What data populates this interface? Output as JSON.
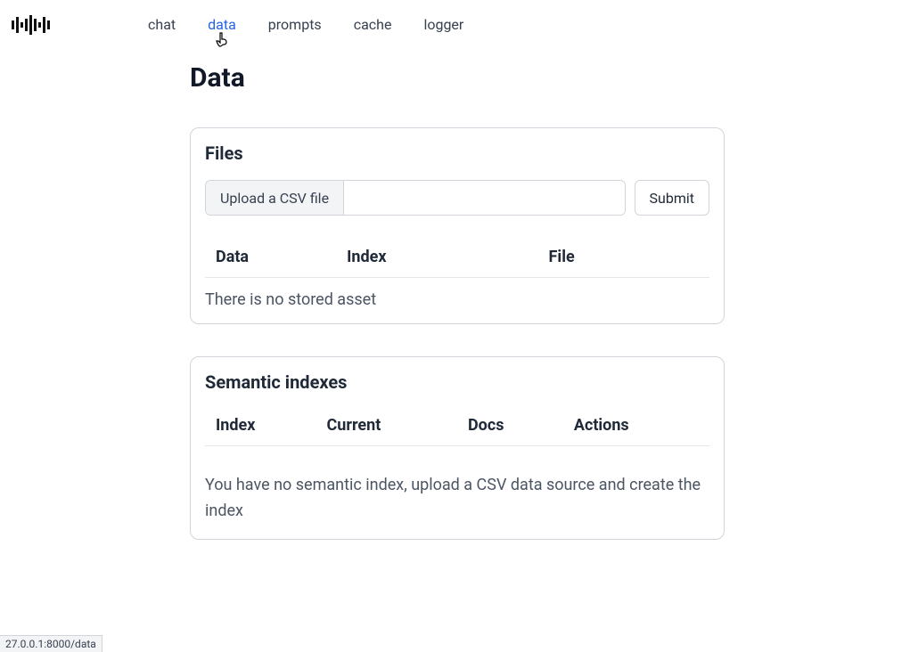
{
  "nav": {
    "items": [
      {
        "label": "chat",
        "active": false
      },
      {
        "label": "data",
        "active": true
      },
      {
        "label": "prompts",
        "active": false
      },
      {
        "label": "cache",
        "active": false
      },
      {
        "label": "logger",
        "active": false
      }
    ]
  },
  "page": {
    "title": "Data"
  },
  "files_card": {
    "title": "Files",
    "upload_button": "Upload a CSV file",
    "submit_button": "Submit",
    "columns": [
      "Data",
      "Index",
      "File"
    ],
    "empty_message": "There is no stored asset"
  },
  "indexes_card": {
    "title": "Semantic indexes",
    "columns": [
      "Index",
      "Current",
      "Docs",
      "Actions"
    ],
    "empty_message": "You have no semantic index, upload a CSV data source and create the index"
  },
  "status_bar": {
    "text": "27.0.0.1:8000/data"
  }
}
